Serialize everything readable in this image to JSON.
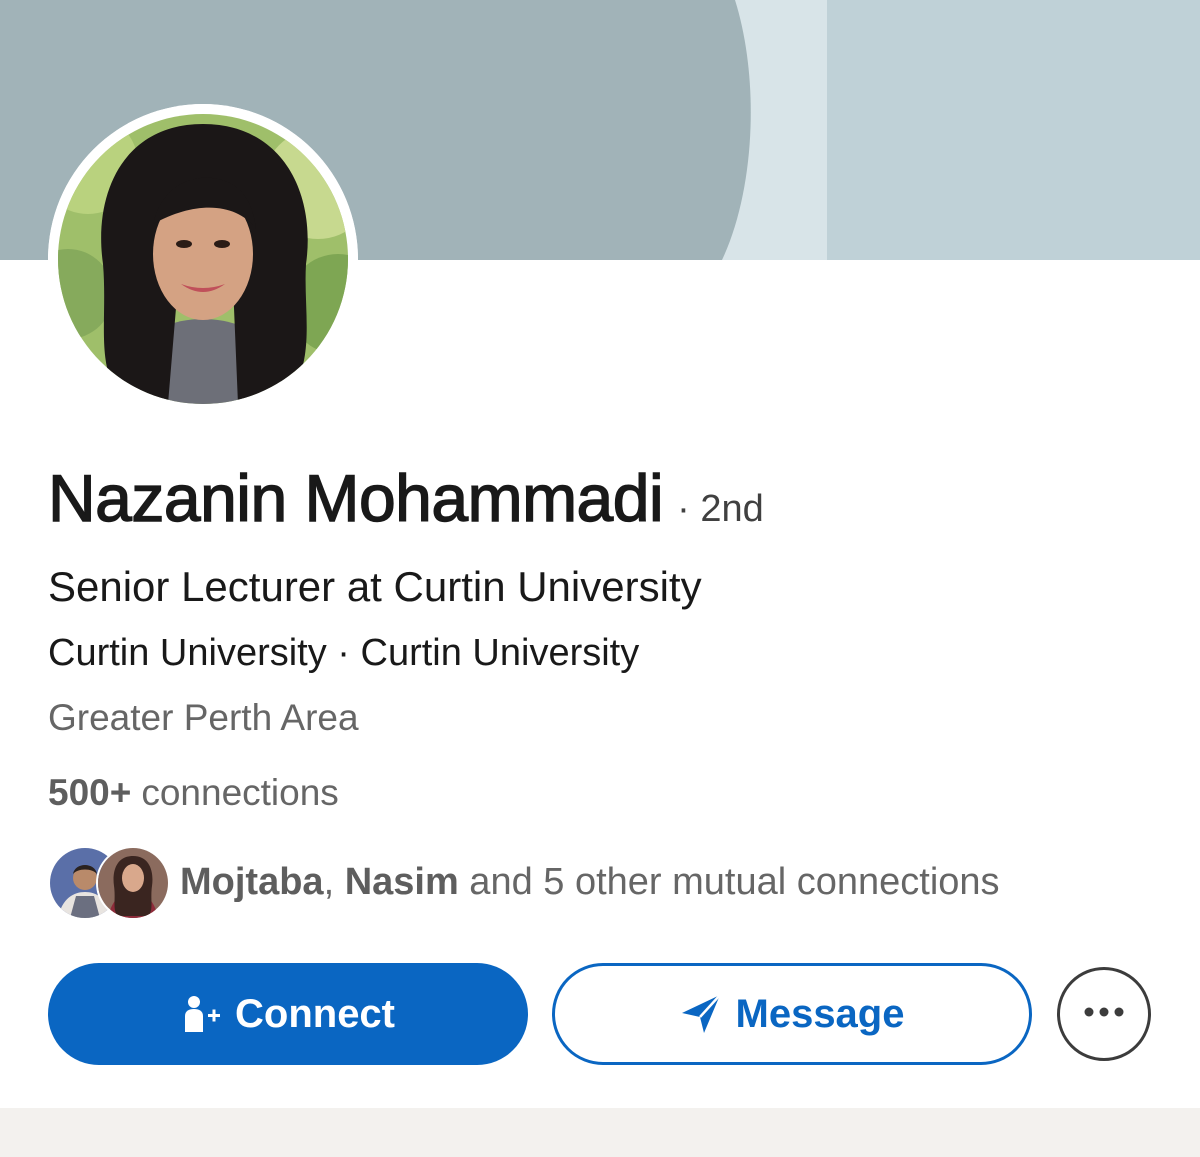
{
  "profile": {
    "name": "Nazanin Mohammadi",
    "degree": "· 2nd",
    "headline": "Senior Lecturer at Curtin University",
    "company_line": "Curtin University · Curtin University",
    "location": "Greater Perth Area",
    "connections_count": "500+",
    "connections_label": "connections"
  },
  "mutual": {
    "name1": "Mojtaba",
    "separator": ", ",
    "name2": "Nasim",
    "rest": " and 5 other mutual connections"
  },
  "actions": {
    "connect_label": "Connect",
    "message_label": "Message",
    "more_icon": "ellipsis-icon"
  },
  "colors": {
    "accent": "#0a66c2",
    "banner_dark": "#a1b3b8",
    "banner_light": "#c0d2d8",
    "background_strip": "#f3f1ee"
  }
}
